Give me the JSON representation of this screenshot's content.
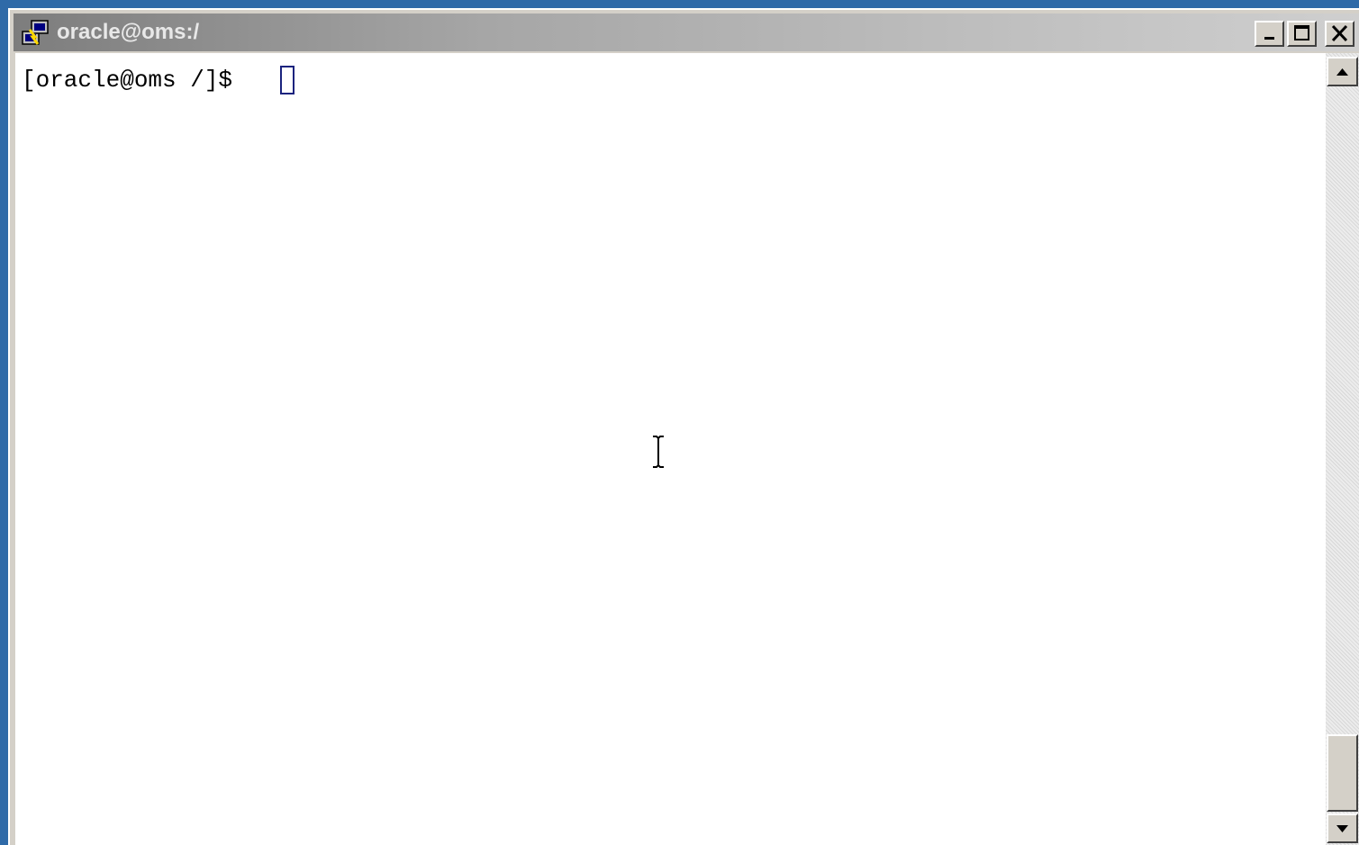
{
  "window": {
    "title": "oracle@oms:/",
    "icon": "putty-terminal-icon",
    "controls": {
      "minimize_icon": "minimize-icon",
      "maximize_icon": "maximize-icon",
      "close_icon": "close-icon"
    }
  },
  "terminal": {
    "prompt": "[oracle@oms /]$ ",
    "input_value": "",
    "mouse_cursor": "text-ibeam-cursor",
    "background": "#ffffff",
    "foreground": "#000000"
  },
  "scrollbar": {
    "up_icon": "scroll-up-arrow-icon",
    "down_icon": "scroll-down-arrow-icon",
    "position": 1.0
  },
  "colors": {
    "desktop": "#2f6aa8",
    "titlebar_start": "#7d7d7d",
    "titlebar_end": "#cfcfcf",
    "cursor_outline": "#1a237e"
  }
}
